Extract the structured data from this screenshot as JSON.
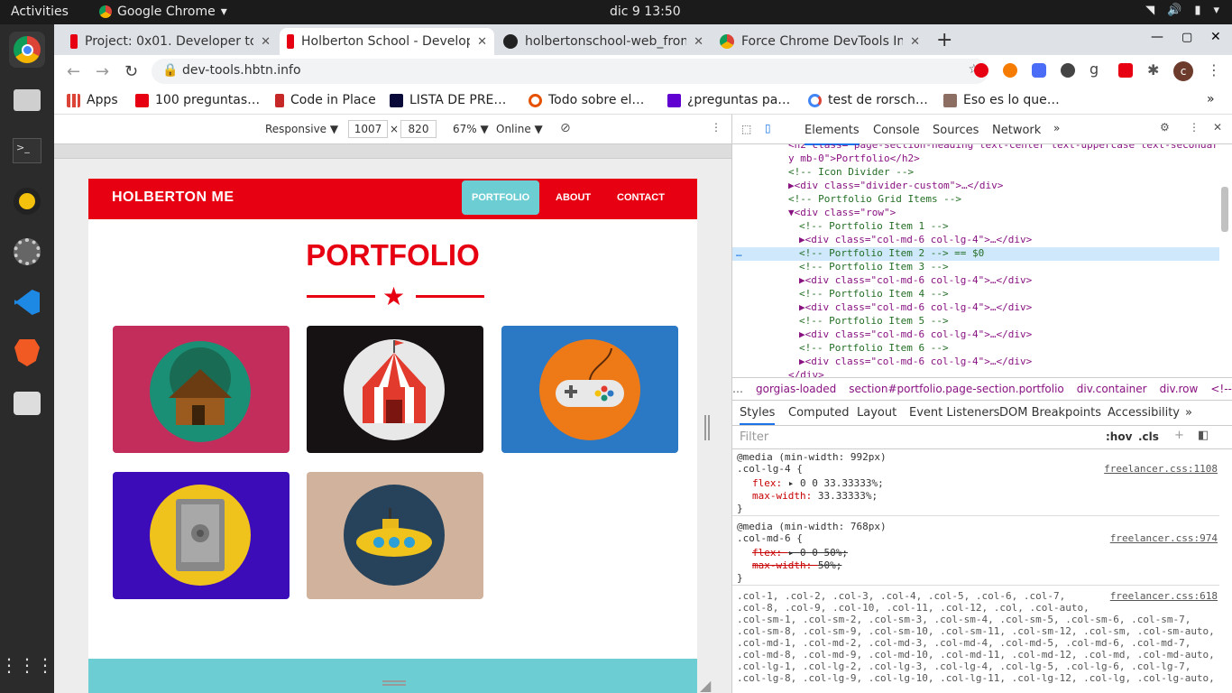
{
  "system": {
    "activities": "Activities",
    "app": "Google Chrome",
    "clock": "dic 9  13:50"
  },
  "tabs": [
    {
      "title": "Project: 0x01. Developer to",
      "close": "✕"
    },
    {
      "title": "Holberton School - Develop",
      "close": "✕"
    },
    {
      "title": "holbertonschool-web_front",
      "close": "✕"
    },
    {
      "title": "Force Chrome DevTools In",
      "close": "✕"
    }
  ],
  "new_tab": "+",
  "url": "dev-tools.hbtn.info",
  "bookmarks": [
    "Apps",
    "100 preguntas…",
    "Code in Place",
    "LISTA DE PRE…",
    "Todo sobre el…",
    "¿preguntas pa…",
    "test de rorsch…",
    "Eso es lo que…"
  ],
  "device_toolbar": {
    "mode": "Responsive ▼",
    "width": "1007",
    "x": "×",
    "height": "820",
    "zoom": "67% ▼",
    "network": "Online ▼"
  },
  "site": {
    "brand": "HOLBERTON ME",
    "nav": [
      "PORTFOLIO",
      "ABOUT",
      "CONTACT"
    ],
    "title": "PORTFOLIO"
  },
  "portfolio": [
    {
      "name": "cabin",
      "color": "#c22d5c"
    },
    {
      "name": "circus tent",
      "color": "#161213"
    },
    {
      "name": "game controller",
      "color": "#2b78c5"
    },
    {
      "name": "safe",
      "color": "#3b0cb8"
    },
    {
      "name": "submarine",
      "color": "#d1b29c"
    }
  ],
  "devtools": {
    "tabs": [
      "Elements",
      "Console",
      "Sources",
      "Network"
    ],
    "dom": [
      {
        "indent": 62,
        "text": "<h2 class=\"page-section-heading text-center text-uppercase text-secondar",
        "kind": "tag"
      },
      {
        "indent": 62,
        "text": "y mb-0\">Portfolio</h2>",
        "kind": "tag"
      },
      {
        "indent": 62,
        "text": "<!-- Icon Divider -->",
        "kind": "cm"
      },
      {
        "indent": 62,
        "text": "▶<div class=\"divider-custom\">…</div>",
        "kind": "tag"
      },
      {
        "indent": 62,
        "text": "<!-- Portfolio Grid Items -->",
        "kind": "cm"
      },
      {
        "indent": 62,
        "text": "▼<div class=\"row\">",
        "kind": "tag"
      },
      {
        "indent": 74,
        "text": "<!-- Portfolio Item 1 -->",
        "kind": "cm"
      },
      {
        "indent": 74,
        "text": "▶<div class=\"col-md-6 col-lg-4\">…</div>",
        "kind": "tag"
      },
      {
        "indent": 74,
        "text": "<!-- Portfolio Item 2 --> == $0",
        "kind": "cm"
      },
      {
        "indent": 74,
        "text": "<!-- Portfolio Item 3 -->",
        "kind": "cm"
      },
      {
        "indent": 74,
        "text": "▶<div class=\"col-md-6 col-lg-4\">…</div>",
        "kind": "tag"
      },
      {
        "indent": 74,
        "text": "<!-- Portfolio Item 4 -->",
        "kind": "cm"
      },
      {
        "indent": 74,
        "text": "▶<div class=\"col-md-6 col-lg-4\">…</div>",
        "kind": "tag"
      },
      {
        "indent": 74,
        "text": "<!-- Portfolio Item 5 -->",
        "kind": "cm"
      },
      {
        "indent": 74,
        "text": "▶<div class=\"col-md-6 col-lg-4\">…</div>",
        "kind": "tag"
      },
      {
        "indent": 74,
        "text": "<!-- Portfolio Item 6 -->",
        "kind": "cm"
      },
      {
        "indent": 74,
        "text": "▶<div class=\"col-md-6 col-lg-4\">…</div>",
        "kind": "tag"
      },
      {
        "indent": 62,
        "text": "</div>",
        "kind": "tag"
      }
    ],
    "crumbs": [
      "…",
      "gorgias-loaded",
      "section#portfolio.page-section.portfolio",
      "div.container",
      "div.row",
      "<!-->"
    ],
    "panel_tabs": [
      "Styles",
      "Computed",
      "Layout",
      "Event Listeners",
      "DOM Breakpoints",
      "Accessibility",
      "»"
    ],
    "filter_placeholder": "Filter",
    "hov": ":hov",
    ".cls": ".cls",
    "rules": [
      {
        "media": "@media (min-width: 992px)",
        "selector": ".col-lg-4 {",
        "src": "freelancer.css:1108",
        "props": [
          [
            "flex",
            "▸ 0 0 33.33333%;",
            false
          ],
          [
            "max-width",
            "33.33333%;",
            false
          ]
        ]
      },
      {
        "media": "@media (min-width: 768px)",
        "selector": ".col-md-6 {",
        "src": "freelancer.css:974",
        "props": [
          [
            "flex",
            "▸ 0 0 50%;",
            true
          ],
          [
            "max-width",
            "50%;",
            true
          ]
        ]
      }
    ],
    "grid_selectors": [
      ".col-1, .col-2, .col-3, .col-4, .col-5, .col-6, .col-7,",
      ".col-8, .col-9, .col-10, .col-11, .col-12, .col, .col-auto,",
      ".col-sm-1, .col-sm-2, .col-sm-3, .col-sm-4, .col-sm-5, .col-sm-6, .col-sm-7,",
      ".col-sm-8, .col-sm-9, .col-sm-10, .col-sm-11, .col-sm-12, .col-sm, .col-sm-auto,",
      ".col-md-1, .col-md-2, .col-md-3, .col-md-4, .col-md-5, .col-md-6, .col-md-7,",
      ".col-md-8, .col-md-9, .col-md-10, .col-md-11, .col-md-12, .col-md, .col-md-auto,",
      ".col-lg-1, .col-lg-2, .col-lg-3, .col-lg-4, .col-lg-5, .col-lg-6, .col-lg-7,",
      ".col-lg-8, .col-lg-9, .col-lg-10, .col-lg-11, .col-lg-12, .col-lg, .col-lg-auto,"
    ],
    "grid_src": "freelancer.css:618"
  }
}
